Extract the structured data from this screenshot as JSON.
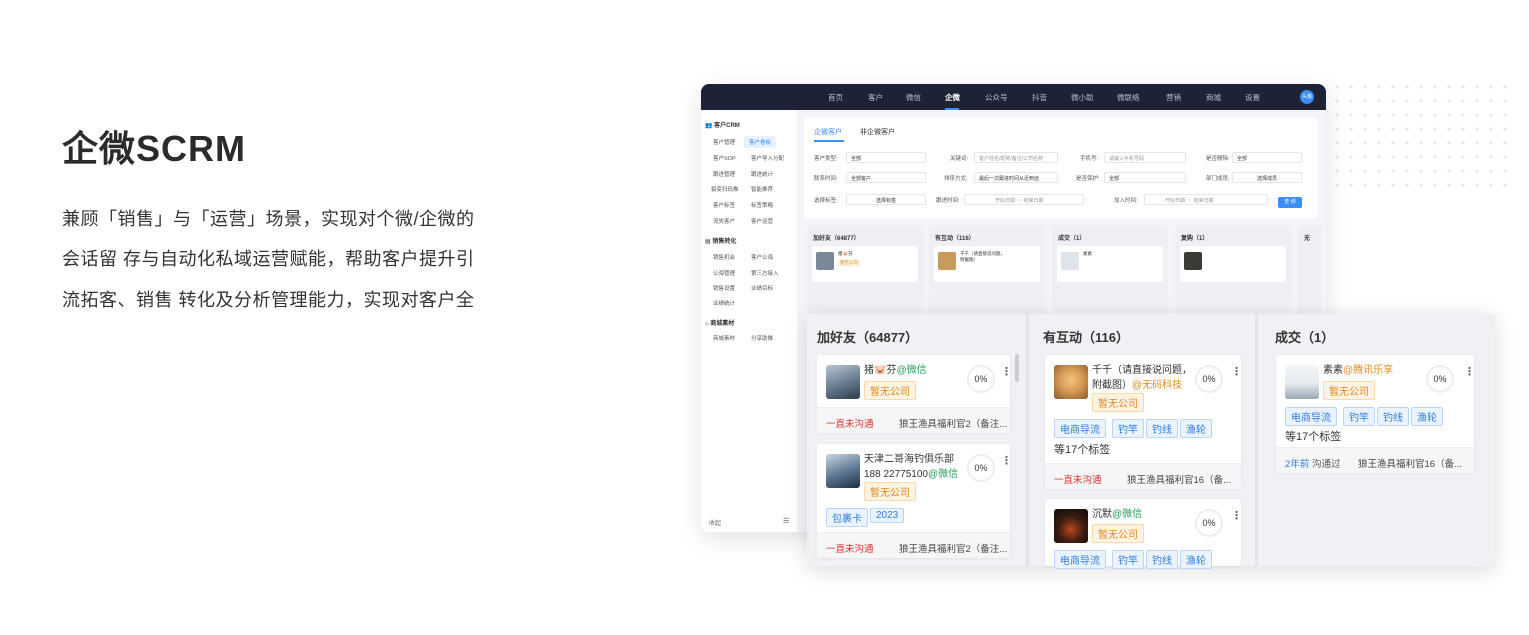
{
  "hero": {
    "title": "企微SCRM",
    "lines": [
      "兼顾「销售」与「运营」场景，实现对个微/企微的",
      "会话留 存与自动化私域运营赋能，帮助客户提升引",
      "流拓客、销售 转化及分析管理能力，实现对客户全"
    ]
  },
  "nav": {
    "items": [
      "首页",
      "客户",
      "微信",
      "企微",
      "公众号",
      "抖音",
      "微小助",
      "微联络",
      "营销",
      "商城",
      "设置"
    ],
    "active": "企微",
    "avatar": "头像"
  },
  "sidebar": {
    "group1": "客户CRM",
    "group1_items": [
      "客户管理",
      "客户看板",
      "客户SOP",
      "客户导入分配",
      "跟进管理",
      "跟进统计",
      "裂变扫码推",
      "智能推荐",
      "客户标签",
      "标签策略",
      "流失客户",
      "客户运营"
    ],
    "group2": "销售转化",
    "group2_items": [
      "销售机会",
      "客户公海",
      "公海管理",
      "第三方接入",
      "销售设置",
      "业绩目标",
      "业绩统计"
    ],
    "group3": "商城素材",
    "group3_items": [
      "商城素材",
      "分享助推"
    ],
    "collapse": "收起"
  },
  "filters": {
    "tabs": [
      "企微客户",
      "非企微客户"
    ],
    "fields": [
      {
        "label": "客户类型:",
        "value": "全部"
      },
      {
        "label": "关键词:",
        "placeholder": "客户姓名/昵称/备注/公司名称"
      },
      {
        "label": "手机号:",
        "placeholder": "请输入手机号码"
      },
      {
        "label": "是否删除:",
        "value": "全部"
      },
      {
        "label": "联系时间:",
        "value": "全部客户"
      },
      {
        "label": "排序方式:",
        "value": "最后一次跟进时间从近到远"
      },
      {
        "label": "是否保护:",
        "value": "全部"
      },
      {
        "label": "部门成员:",
        "value": "选择成员"
      },
      {
        "label": "选择标签:",
        "value": "选择标签"
      },
      {
        "label": "跟进时间:",
        "placeholder": "开始日期"
      },
      {
        "label": "加入时间:",
        "placeholder": "开始日期"
      }
    ],
    "end_placeholder": "结束日期",
    "query_button": "查 询"
  },
  "small_columns": [
    {
      "title": "加好友（64877）"
    },
    {
      "title": "有互动（116）"
    },
    {
      "title": "成交（1）"
    },
    {
      "title": "复购（1）"
    },
    {
      "title": "无"
    }
  ],
  "panels": [
    {
      "title": "加好友（64877）",
      "cards": [
        {
          "name": "猪🐷芬",
          "via": "@微信",
          "company": "暂无公司",
          "pct": "0%",
          "status": "一直未沟通",
          "owner": "狼王渔具福利官2（备注..."
        },
        {
          "name": "天津二哥海钓俱乐部188 22775100",
          "via": "@微信",
          "company": "暂无公司",
          "pct": "0%",
          "tags": [
            "包裹卡",
            "2023"
          ],
          "status": "一直未沟通",
          "owner": "狼王渔具福利官2（备注..."
        }
      ]
    },
    {
      "title": "有互动（116）",
      "cards": [
        {
          "name": "千千（请直接说问题，附截图）",
          "via": "@无码科技",
          "company": "暂无公司",
          "pct": "0%",
          "tags": [
            "电商导流",
            "钓竿",
            "钓线",
            "渔轮"
          ],
          "more_tags": "等17个标签",
          "status": "一直未沟通",
          "owner": "狼王渔具福利官16（备..."
        },
        {
          "name": "沉默",
          "via": "@微信",
          "company": "暂无公司",
          "pct": "0%",
          "tags": [
            "电商导流",
            "钓竿",
            "钓线",
            "渔轮"
          ]
        }
      ]
    },
    {
      "title": "成交（1）",
      "cards": [
        {
          "name": "素素",
          "via": "@腾讯乐享",
          "company": "暂无公司",
          "pct": "0%",
          "tags": [
            "电商导流",
            "钓竿",
            "钓线",
            "渔轮"
          ],
          "more_tags": "等17个标签",
          "status_time": "2年前",
          "status": "沟通过",
          "owner": "狼王渔具福利官16（备..."
        }
      ]
    }
  ]
}
